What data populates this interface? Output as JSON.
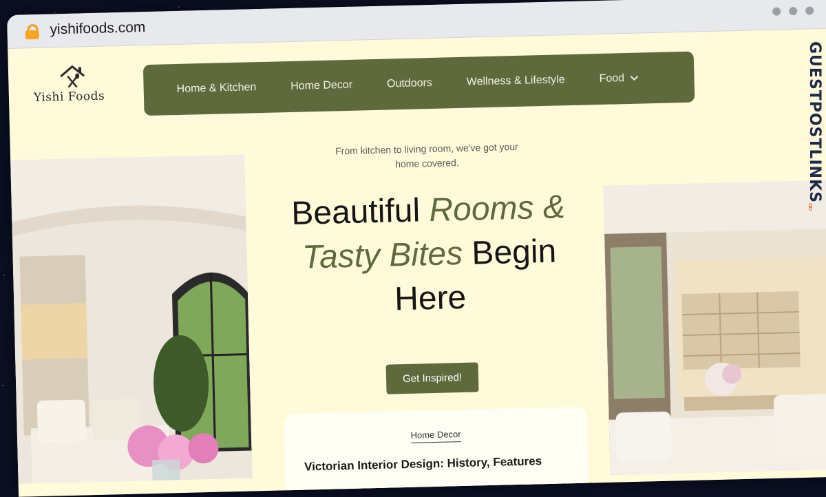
{
  "browser": {
    "url": "yishifoods.com"
  },
  "logo": {
    "brand": "Yishi Foods"
  },
  "nav": {
    "items": [
      "Home & Kitchen",
      "Home Decor",
      "Outdoors",
      "Wellness & Lifestyle"
    ],
    "dropdown_label": "Food"
  },
  "hero": {
    "subtitle": "From kitchen to living room, we've got your home covered.",
    "h_part1": "Beautiful ",
    "h_italic1": "Rooms &",
    "h_italic2": "Tasty Bites",
    "h_part2": " Begin",
    "h_part3": "Here",
    "cta_label": "Get Inspired!"
  },
  "card": {
    "category": "Home Decor",
    "title": "Victorian Interior Design: History, Features"
  },
  "watermark": {
    "text": "GUESTPOSTLINKS"
  },
  "colors": {
    "brand_green": "#5f6a3c",
    "page_bg": "#fffad9",
    "watermark_orange": "#f26a2e"
  }
}
